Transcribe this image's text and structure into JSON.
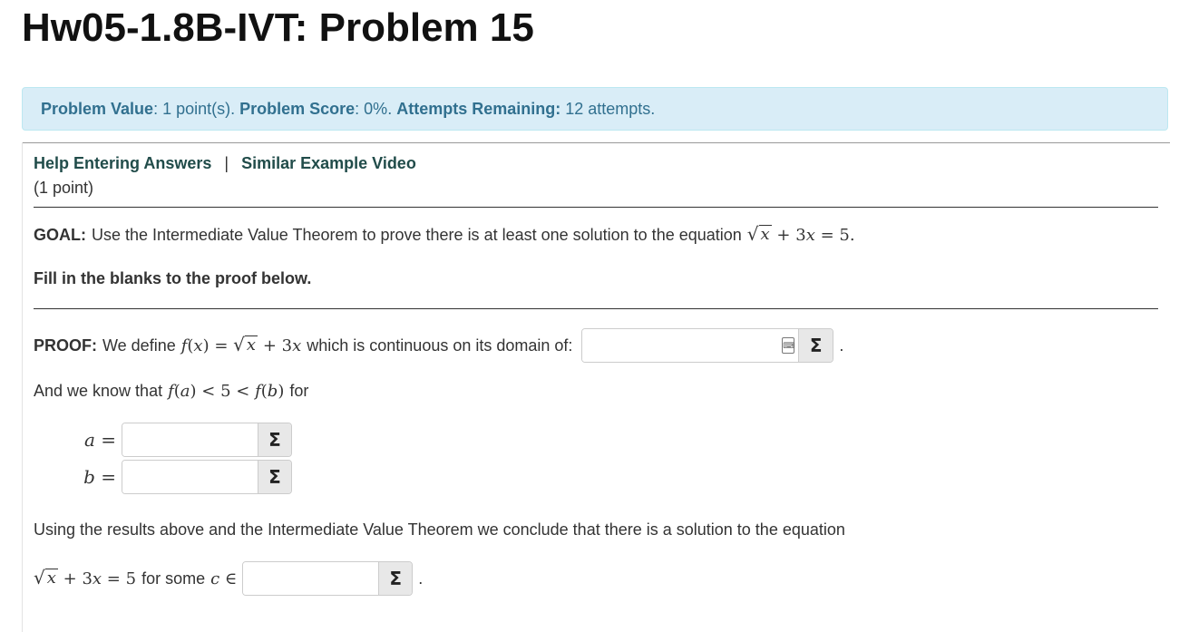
{
  "page": {
    "title": "Hw05-1.8B-IVT: Problem 15"
  },
  "info": {
    "value_label": "Problem Value",
    "value_text": ": 1 point(s).",
    "score_label": "Problem Score",
    "score_text": ": 0%.",
    "attempts_label": "Attempts Remaining:",
    "attempts_text": "12 attempts."
  },
  "links": {
    "help": "Help Entering Answers",
    "separator": "|",
    "video": "Similar Example Video"
  },
  "points": "(1 point)",
  "goal": {
    "label": "GOAL:",
    "text": "Use the Intermediate Value Theorem to prove there is at least one solution to the equation"
  },
  "fill_text": "Fill in the blanks to the proof below.",
  "proof": {
    "label": "PROOF:",
    "text_before": "We define",
    "text_after": "which is continuous on its domain of:",
    "domain_value": ""
  },
  "know": {
    "before": "And we know that",
    "after": "for"
  },
  "a_value": "",
  "b_value": "",
  "conclude_text": "Using the results above and the Intermediate Value Theorem we conclude that there is a solution to the equation",
  "for_some_text": "for some",
  "c_value": "",
  "icons": {
    "sigma": "Σ",
    "keyboard": "keyboard-icon"
  }
}
